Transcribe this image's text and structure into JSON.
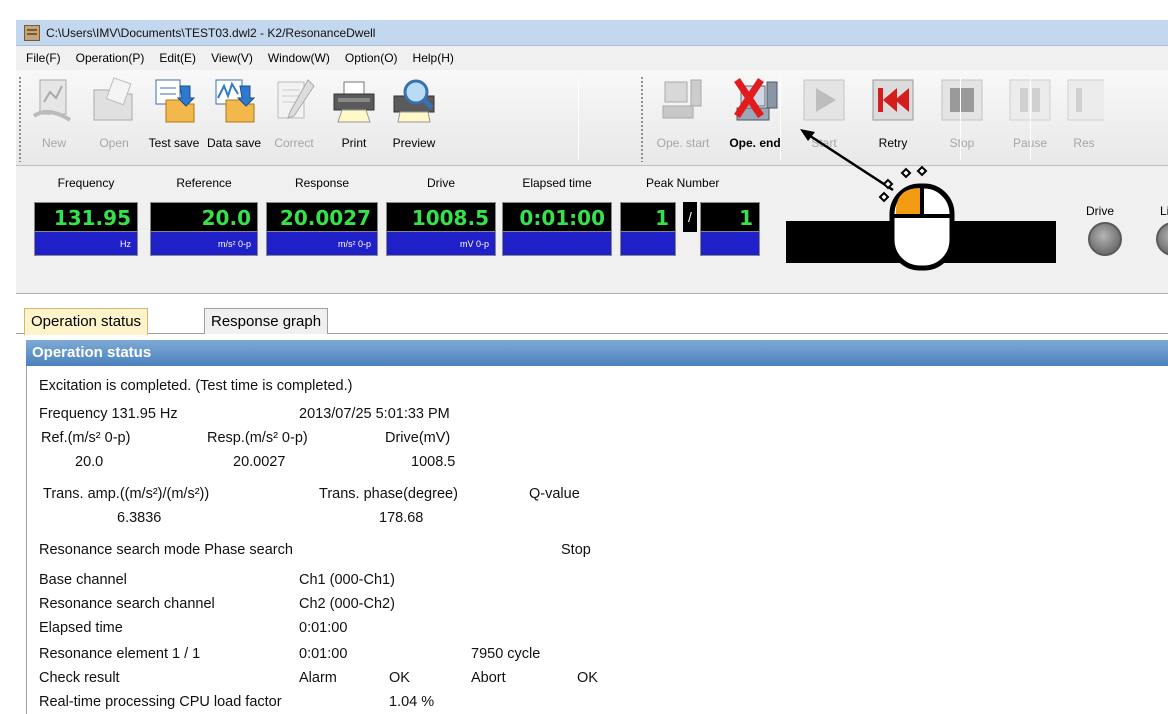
{
  "window": {
    "title": "C:\\Users\\IMV\\Documents\\TEST03.dwl2 - K2/ResonanceDwell"
  },
  "menu": [
    "File(F)",
    "Operation(P)",
    "Edit(E)",
    "View(V)",
    "Window(W)",
    "Option(O)",
    "Help(H)"
  ],
  "toolbar": {
    "new": "New",
    "open": "Open",
    "test_save": "Test save",
    "data_save": "Data save",
    "correct": "Correct",
    "print": "Print",
    "preview": "Preview",
    "ope_start": "Ope. start",
    "ope_end": "Ope. end",
    "start": "Start",
    "retry": "Retry",
    "stop": "Stop",
    "pause": "Pause",
    "restart": "Res"
  },
  "meters": {
    "frequency": {
      "label": "Frequency",
      "value": "131.95",
      "unit": "Hz"
    },
    "reference": {
      "label": "Reference",
      "value": "20.0",
      "unit": "m/s² 0-p"
    },
    "response": {
      "label": "Response",
      "value": "20.0027",
      "unit": "m/s² 0-p"
    },
    "drive": {
      "label": "Drive",
      "value": "1008.5",
      "unit": "mV 0-p"
    },
    "elapsed": {
      "label": "Elapsed time",
      "value": "0:01:00",
      "unit": ""
    },
    "peak": {
      "label": "Peak Number",
      "value": "1",
      "sep": "/",
      "total": "1"
    }
  },
  "lamps": {
    "drive": "Drive",
    "limit": "Li"
  },
  "tabs": {
    "operation_status": "Operation status",
    "response_graph": "Response graph"
  },
  "status": {
    "header": "Operation status",
    "excitation": "Excitation is completed. (Test time is completed.)",
    "frequency_line": "Frequency 131.95 Hz",
    "datetime": "2013/07/25 5:01:33 PM",
    "ref_label": "Ref.(m/s² 0-p)",
    "resp_label": "Resp.(m/s² 0-p)",
    "drive_label": "Drive(mV)",
    "ref_value": "20.0",
    "resp_value": "20.0027",
    "drive_value": "1008.5",
    "trans_amp_label": "Trans. amp.((m/s²)/(m/s²))",
    "trans_phase_label": "Trans. phase(degree)",
    "q_label": "Q-value",
    "trans_amp_value": "6.3836",
    "trans_phase_value": "178.68",
    "search_mode": "Resonance search mode  Phase search",
    "search_state": "Stop",
    "base_channel_label": "Base channel",
    "base_channel_value": "Ch1 (000-Ch1)",
    "search_channel_label": "Resonance search channel",
    "search_channel_value": "Ch2 (000-Ch2)",
    "elapsed_label": "Elapsed time",
    "elapsed_value": "0:01:00",
    "element_label": "Resonance element   1 / 1",
    "element_time": "0:01:00",
    "element_cycle": "7950 cycle",
    "check_label": "Check result",
    "alarm_label": "Alarm",
    "alarm_value": "OK",
    "abort_label": "Abort",
    "abort_value": "OK",
    "cpu_label": "Real-time processing CPU load factor",
    "cpu_value": "1.04 %"
  },
  "colors": {
    "meter_text": "#36e24c",
    "unit_bg": "#2020c8",
    "header_bg": "#4b81bd",
    "active_tab": "#fff3cc",
    "mouse_highlight": "#f39c12"
  }
}
